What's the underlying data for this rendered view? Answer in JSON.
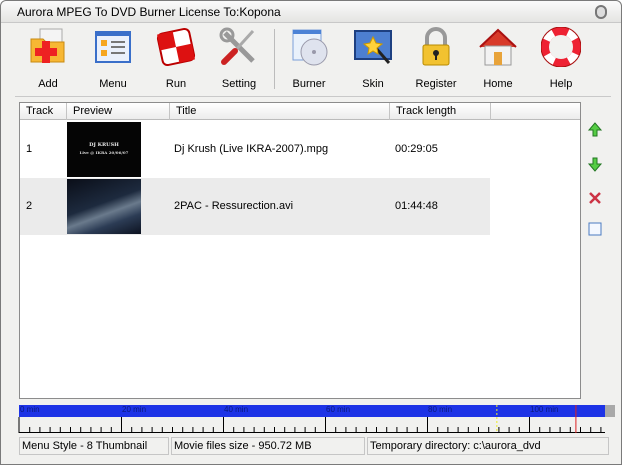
{
  "window": {
    "title": "Aurora MPEG To DVD Burner License To:Kopona"
  },
  "toolbar": [
    {
      "id": "add",
      "label": "Add",
      "icon": "add-folder-icon"
    },
    {
      "id": "menu",
      "label": "Menu",
      "icon": "menu-icon"
    },
    {
      "id": "run",
      "label": "Run",
      "icon": "run-flag-icon"
    },
    {
      "id": "setting",
      "label": "Setting",
      "icon": "tools-icon"
    },
    {
      "id": "burner",
      "label": "Burner",
      "icon": "disc-icon"
    },
    {
      "id": "skin",
      "label": "Skin",
      "icon": "skin-wand-icon"
    },
    {
      "id": "register",
      "label": "Register",
      "icon": "lock-icon"
    },
    {
      "id": "home",
      "label": "Home",
      "icon": "home-icon"
    },
    {
      "id": "help",
      "label": "Help",
      "icon": "lifebuoy-icon"
    }
  ],
  "list": {
    "columns": [
      "Track",
      "Preview",
      "Title",
      "Track length"
    ],
    "rows": [
      {
        "track": "1",
        "title": "Dj Krush (Live IKRA-2007).mpg",
        "length": "00:29:05",
        "thumb_line1": "DJ KRUSH",
        "thumb_line2": "Live @ IKRA 20/06/07"
      },
      {
        "track": "2",
        "title": "2PAC - Ressurection.avi",
        "length": "01:44:48"
      }
    ]
  },
  "side_buttons": [
    "move-up",
    "move-down",
    "delete",
    "select"
  ],
  "timeline": {
    "labels": [
      "0 min",
      "20 min",
      "40 min",
      "60 min",
      "80 min",
      "100 min"
    ],
    "max_minutes": 115,
    "used_minutes": 93.5,
    "limit_minutes": 109
  },
  "status": {
    "menu_style": "Menu Style - 8 Thumbnail",
    "size": "Movie files size - 950.72 MB",
    "temp": "Temporary directory: c:\\aurora_dvd"
  },
  "colors": {
    "timeline": "#1d33e6",
    "row_alt": "#ebebeb"
  }
}
